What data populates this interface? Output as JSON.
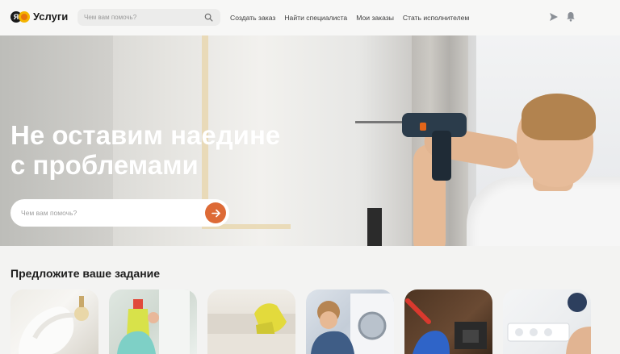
{
  "brand": {
    "logo_letter": "Я",
    "name": "Услуги"
  },
  "search": {
    "placeholder": "Чем вам помочь?"
  },
  "nav": [
    {
      "label": "Создать заказ"
    },
    {
      "label": "Найти специалиста"
    },
    {
      "label": "Мои заказы"
    },
    {
      "label": "Стать исполнителем"
    }
  ],
  "hero": {
    "title_line1": "Не оставим наедине",
    "title_line2": "с проблемами",
    "search_placeholder": "Чем вам помочь?"
  },
  "section": {
    "title": "Предложите ваше задание"
  },
  "colors": {
    "accent": "#dd6a36",
    "background": "#f3f3f2",
    "header": "#f7f7f6"
  },
  "icons": [
    "search-icon",
    "send-icon",
    "bell-icon",
    "arrow-right-icon"
  ]
}
